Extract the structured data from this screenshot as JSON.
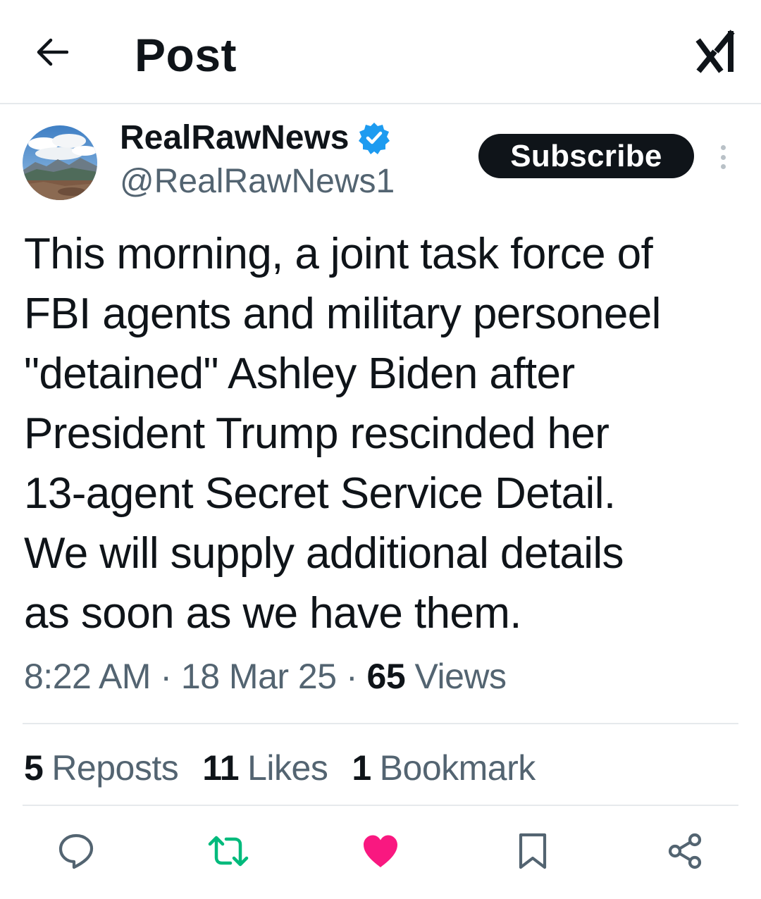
{
  "header": {
    "title": "Post",
    "back_icon": "arrow-left-icon",
    "grok_icon": "grok-icon"
  },
  "author": {
    "display_name": "RealRawNews",
    "handle": "@RealRawNews1",
    "verified": true,
    "verified_color": "#1d9bf0"
  },
  "subscribe_label": "Subscribe",
  "post": {
    "text": "This morning, a joint task force of\nFBI agents and military personeel\n\"detained\" Ashley Biden after\nPresident Trump rescinded her\n13-agent Secret Service Detail.\nWe will supply additional details\nas soon as we have them."
  },
  "meta": {
    "time": "8:22 AM",
    "date": "18 Mar 25",
    "views_count": "65",
    "views_label": "Views",
    "separator": "·"
  },
  "stats": {
    "reposts_count": "5",
    "reposts_label": "Reposts",
    "likes_count": "11",
    "likes_label": "Likes",
    "bookmarks_count": "1",
    "bookmarks_label": "Bookmark"
  },
  "actions": {
    "reply_icon": "reply-icon",
    "repost_icon": "repost-icon",
    "like_icon": "heart-icon",
    "bookmark_icon": "bookmark-icon",
    "share_icon": "share-icon",
    "repost_color": "#00ba7c",
    "like_color": "#f91880",
    "icon_color": "#536471"
  }
}
